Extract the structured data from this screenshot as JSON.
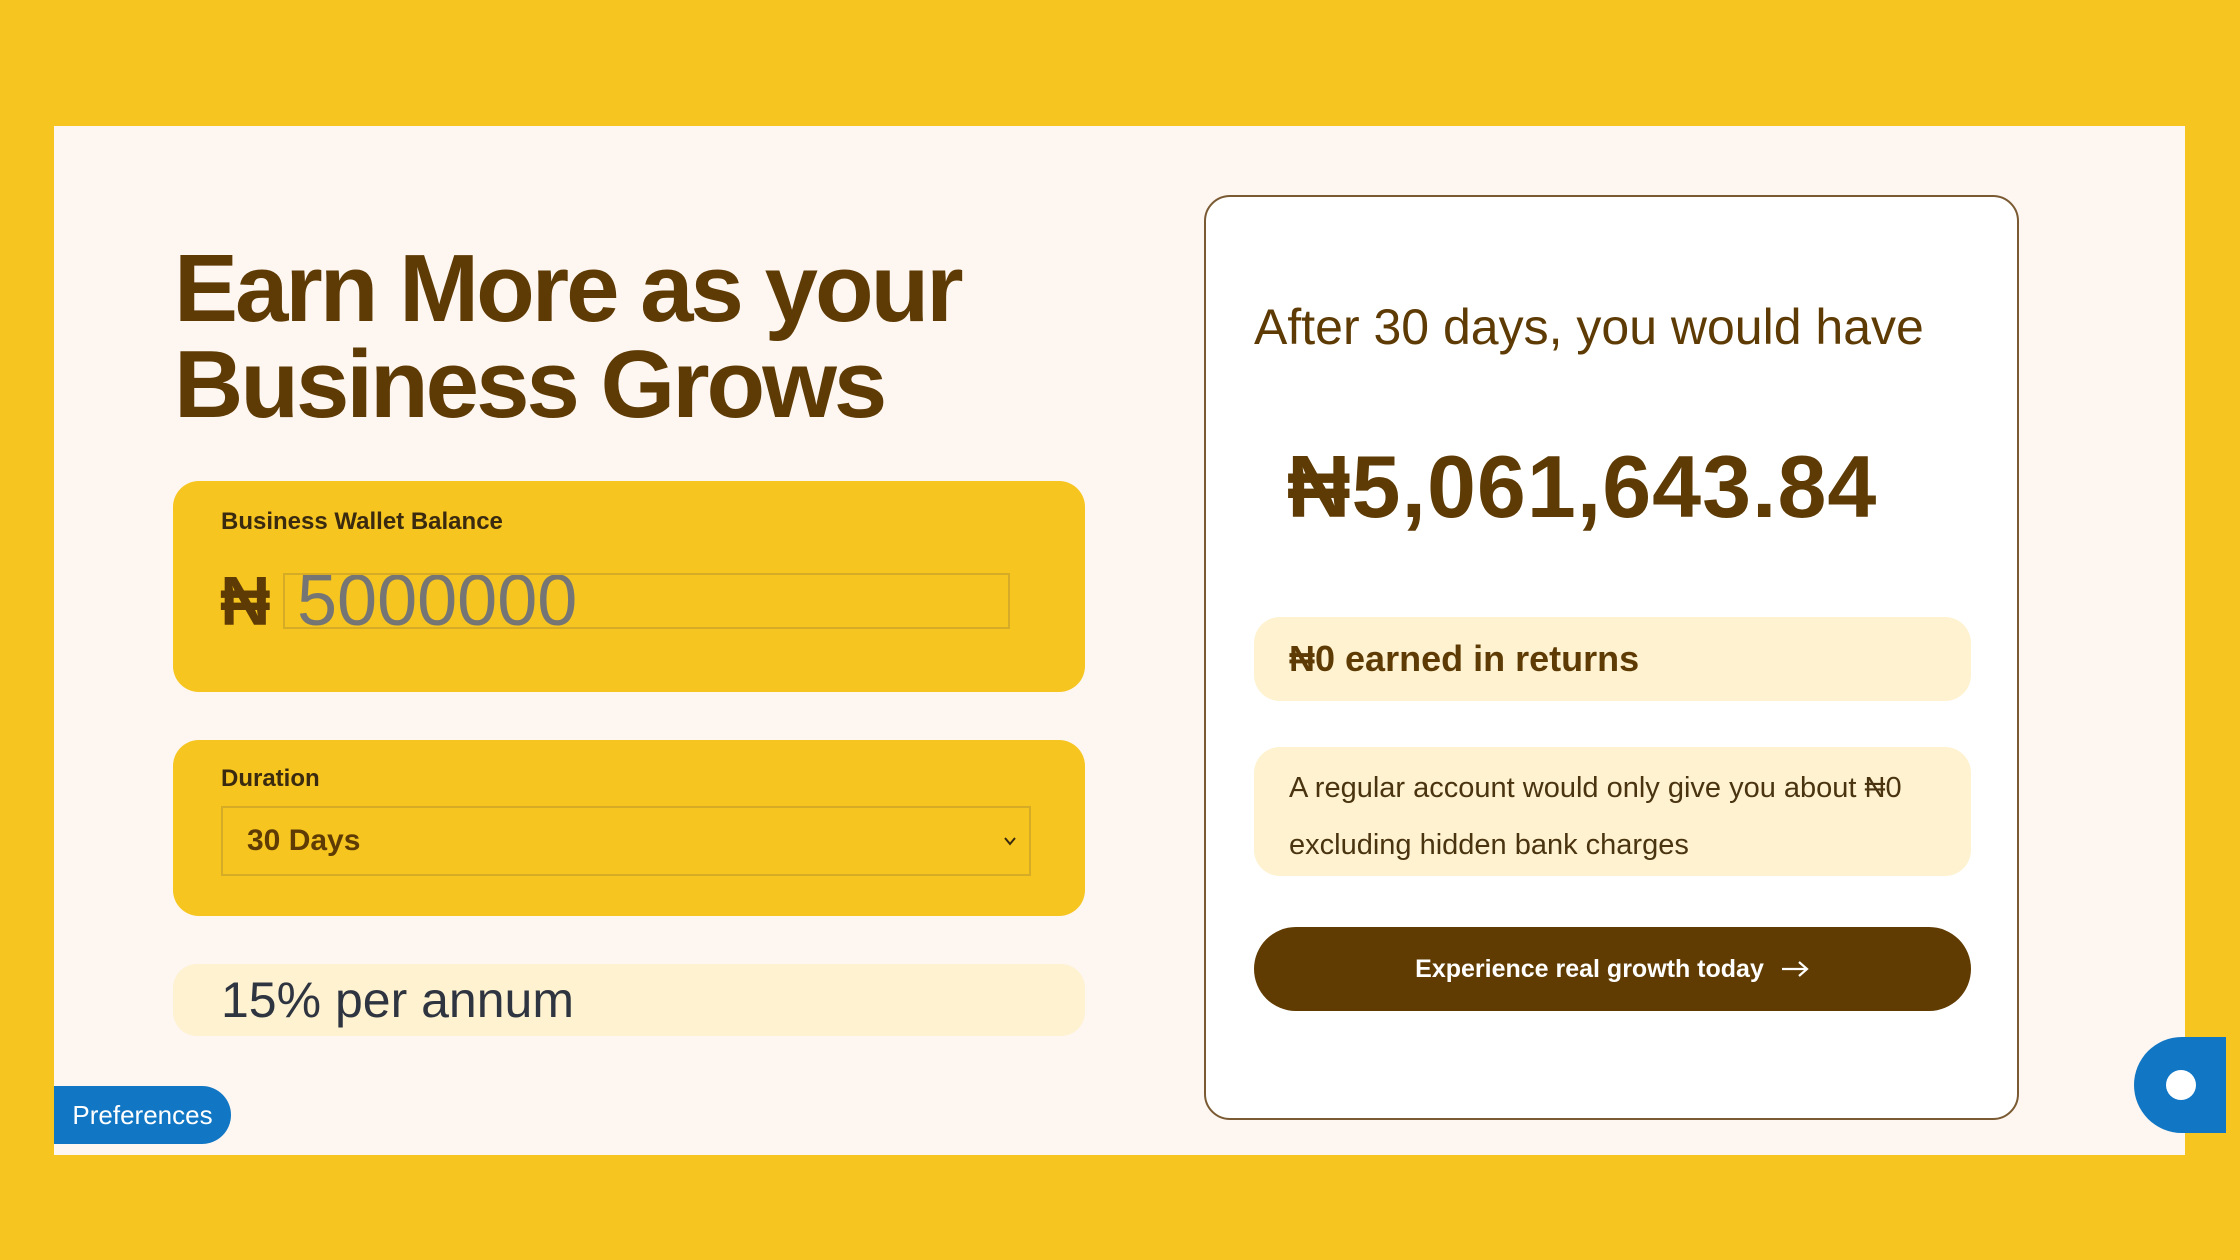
{
  "headline": [
    "Earn More as your",
    "Business Grows"
  ],
  "wallet": {
    "label": "Business Wallet Balance",
    "currency_symbol": "₦",
    "placeholder": "5000000"
  },
  "duration": {
    "label": "Duration",
    "selected": "30 Days"
  },
  "rate": "15% per annum",
  "result": {
    "heading": "After 30 days, you would have",
    "amount": "₦5,061,643.84",
    "returns": "₦0 earned in returns",
    "comparison_line1": "A regular account would only give you about ₦0",
    "comparison_line2": "excluding hidden bank charges",
    "cta": "Experience real growth today"
  },
  "preferences_label": "Preferences",
  "colors": {
    "page_background": "#F6C51F",
    "panel_background": "#FEF6F1",
    "brand_brown": "#5E3B04",
    "cta_background": "#613C02",
    "pill_background": "#FEF2D0",
    "preferences_blue": "#1177C4"
  },
  "icons": {
    "select_chevron": "chevron-down-icon",
    "cta_arrow": "arrow-right-icon",
    "chat": "chat-icon"
  }
}
